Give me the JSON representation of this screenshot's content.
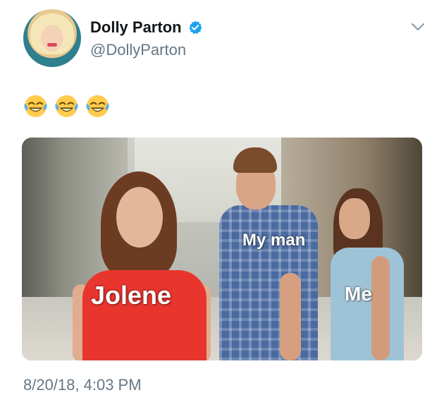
{
  "author": {
    "display_name": "Dolly Parton",
    "handle": "@DollyParton",
    "verified_icon": "verified-badge-icon",
    "avatar": "profile-photo"
  },
  "menu": {
    "icon": "chevron-down-icon"
  },
  "tweet": {
    "emoji_icons": [
      "face-with-tears-of-joy-icon",
      "face-with-tears-of-joy-icon",
      "face-with-tears-of-joy-icon"
    ],
    "timestamp": "8/20/18, 4:03 PM"
  },
  "media": {
    "labels": {
      "my_man": "My man",
      "jolene": "Jolene",
      "me": "Me"
    }
  },
  "colors": {
    "name_text": "#14171a",
    "secondary_text": "#657786",
    "verified_blue": "#1da1f2"
  }
}
